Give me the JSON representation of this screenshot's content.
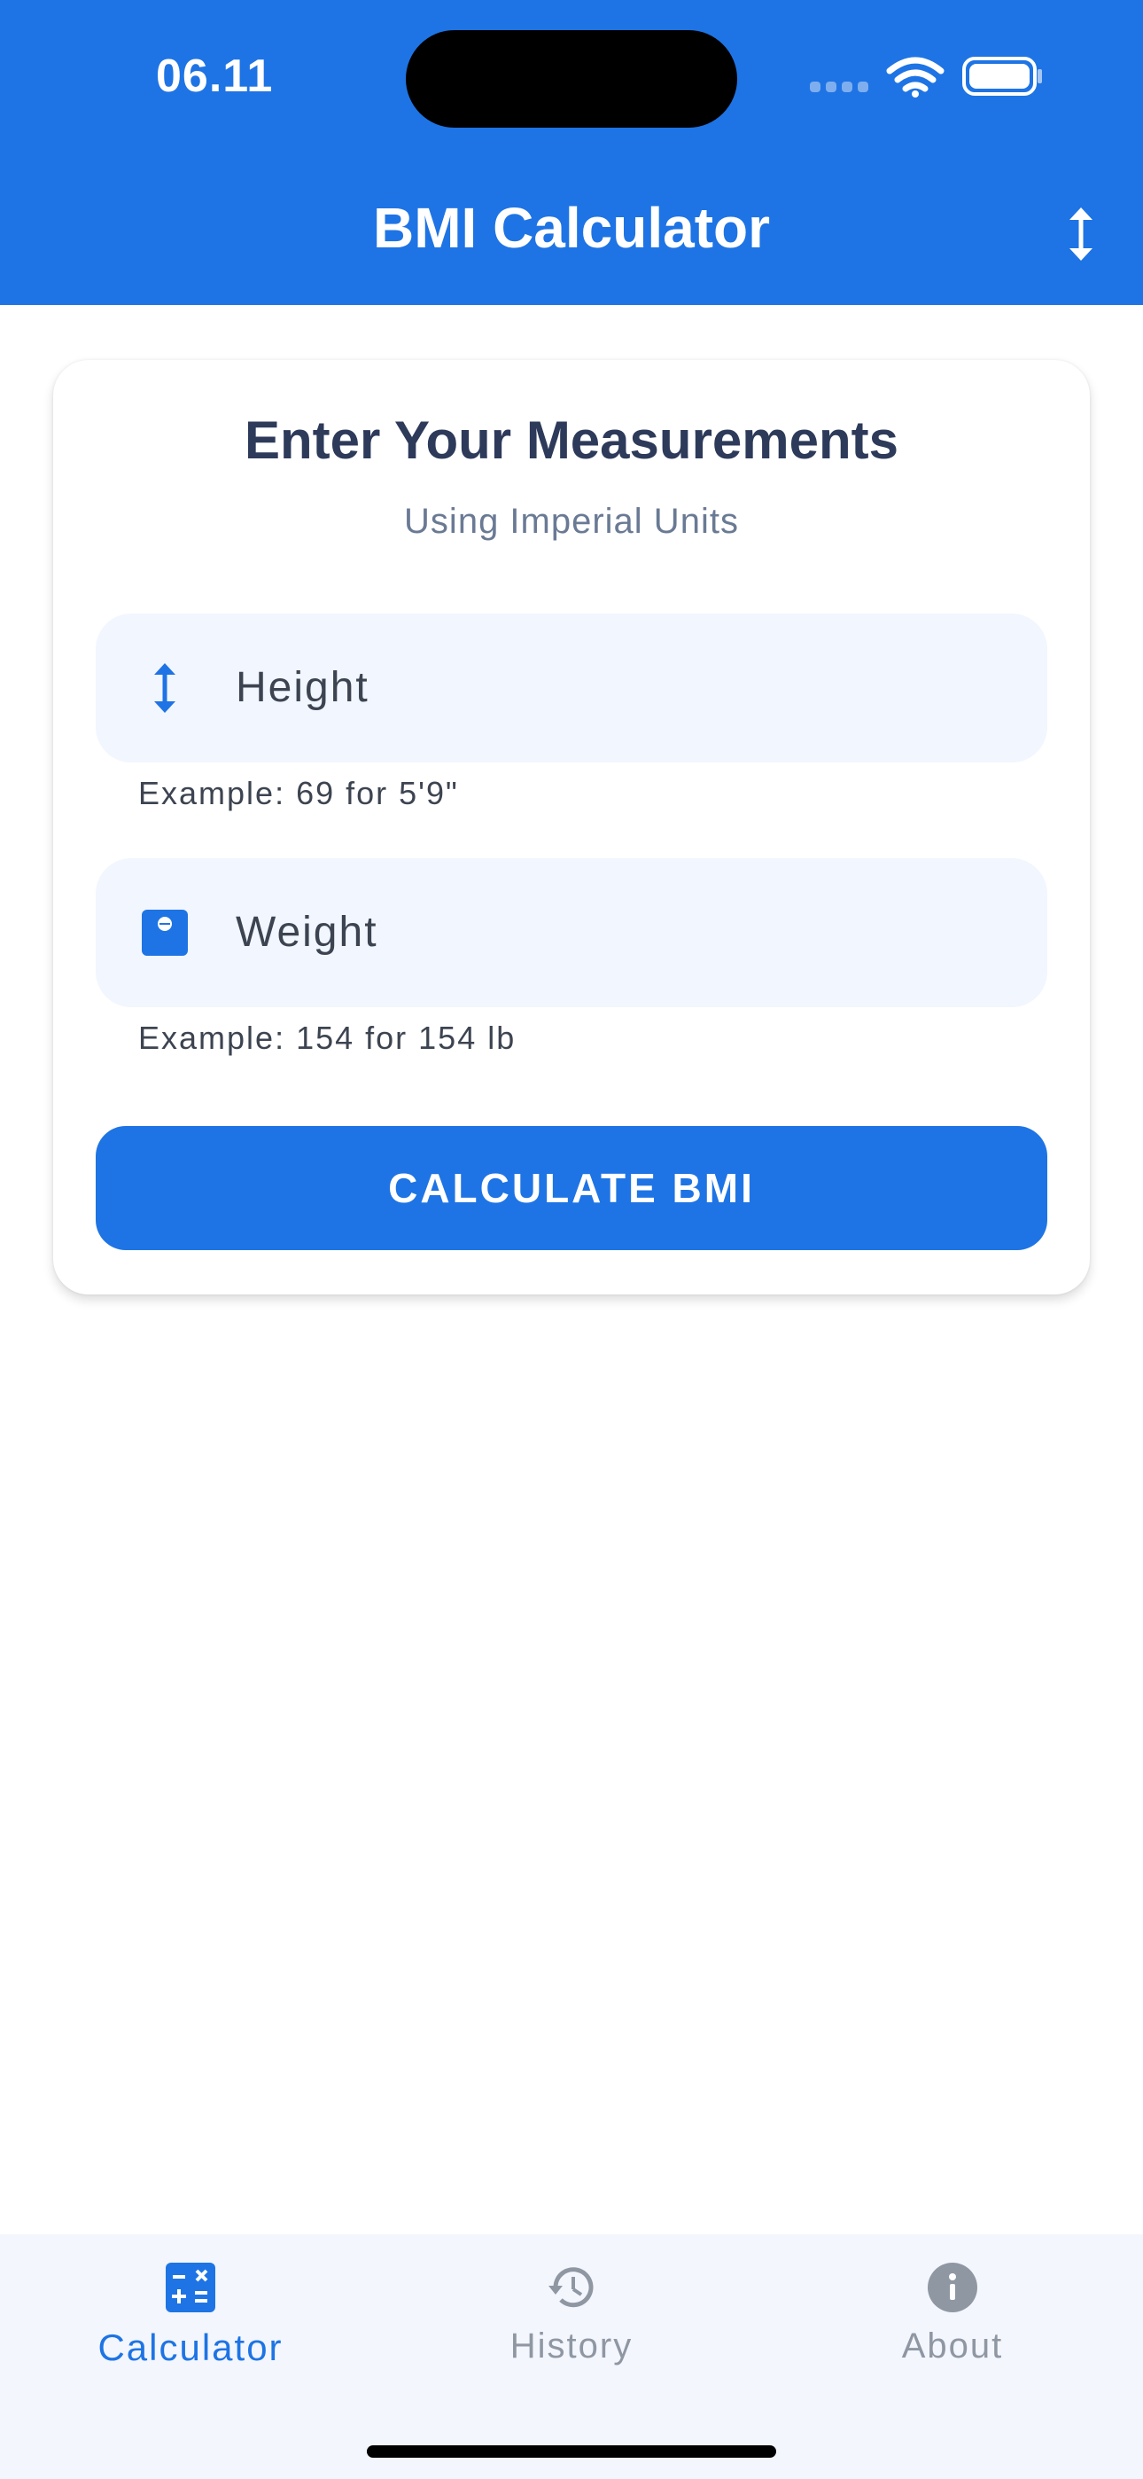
{
  "status_bar": {
    "time": "06.11",
    "icons": [
      "cellular-signal-icon",
      "wifi-icon",
      "battery-icon"
    ]
  },
  "header": {
    "title": "BMI Calculator",
    "toggle_icon": "vertical-arrows-icon"
  },
  "card": {
    "title": "Enter Your Measurements",
    "subtitle": "Using Imperial Units",
    "height_field": {
      "icon": "height-icon",
      "placeholder": "Height",
      "helper": "Example: 69 for 5'9\""
    },
    "weight_field": {
      "icon": "scale-icon",
      "placeholder": "Weight",
      "helper": "Example: 154 for 154 lb"
    },
    "calculate_label": "CALCULATE BMI"
  },
  "bottom_nav": {
    "tabs": [
      {
        "label": "Calculator",
        "icon": "calculator-icon",
        "active": true
      },
      {
        "label": "History",
        "icon": "history-icon",
        "active": false
      },
      {
        "label": "About",
        "icon": "info-icon",
        "active": false
      }
    ]
  },
  "colors": {
    "primary": "#1E74E4",
    "field_bg": "#F2F6FE",
    "nav_bg": "#F3F6FC",
    "title_text": "#2D3A5A",
    "subtitle_text": "#6A7A94",
    "inactive_tab": "#8F97A3"
  }
}
